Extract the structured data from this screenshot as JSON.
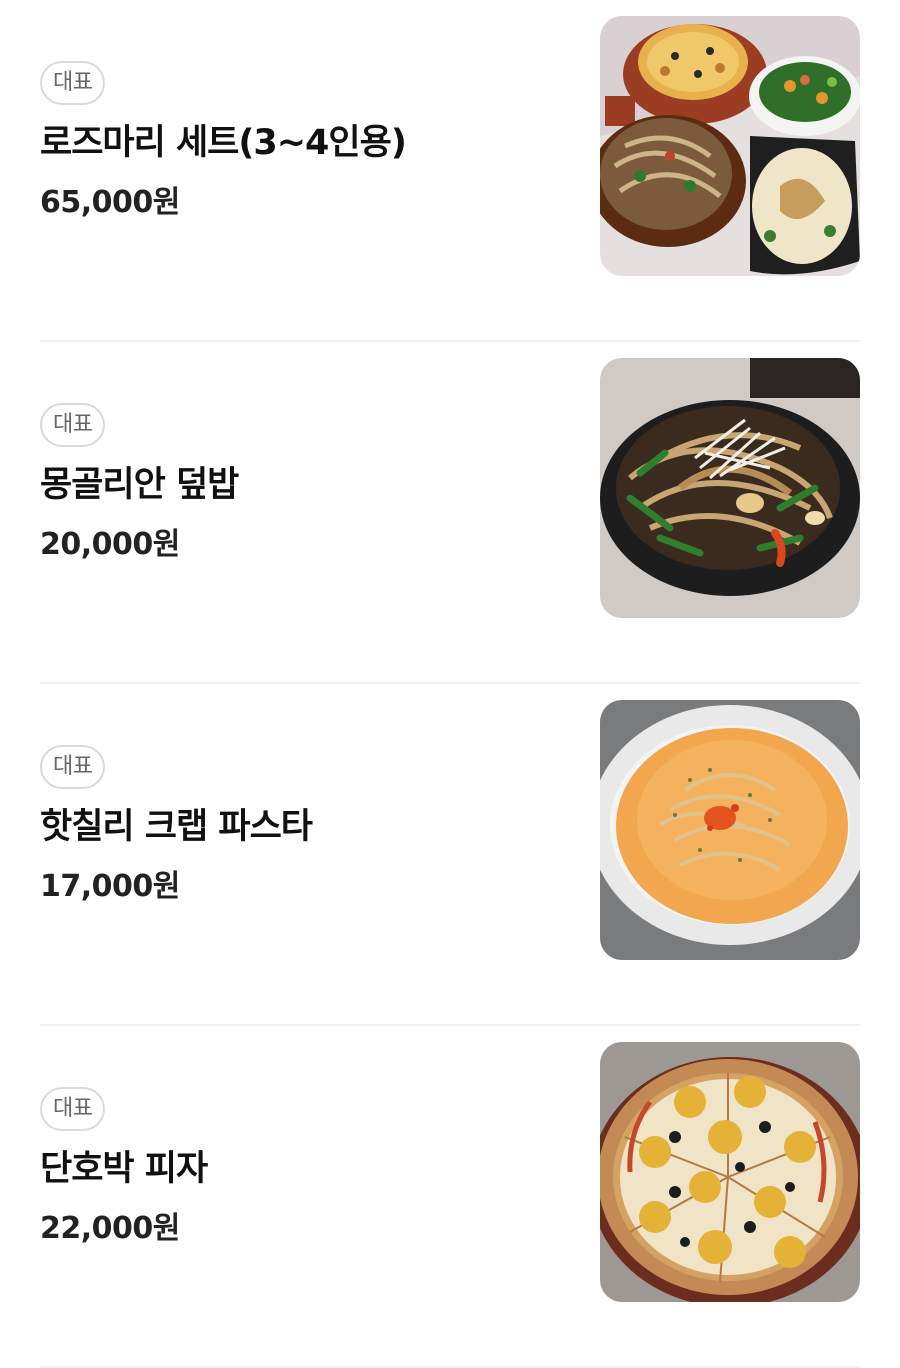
{
  "menu": {
    "items": [
      {
        "badge": "대표",
        "name": "로즈마리 세트(3~4인용)",
        "price": "65,000원",
        "photo_icon": "food-set-photo"
      },
      {
        "badge": "대표",
        "name": "몽골리안 덮밥",
        "price": "20,000원",
        "photo_icon": "stir-fry-rice-photo"
      },
      {
        "badge": "대표",
        "name": "핫칠리 크랩 파스타",
        "price": "17,000원",
        "photo_icon": "crab-pasta-photo"
      },
      {
        "badge": "대표",
        "name": "단호박 피자",
        "price": "22,000원",
        "photo_icon": "pumpkin-pizza-photo"
      }
    ]
  },
  "colors": {
    "badge_border": "#dadada",
    "badge_text": "#666666",
    "divider": "#f0f0f0",
    "name_text": "#111111"
  }
}
